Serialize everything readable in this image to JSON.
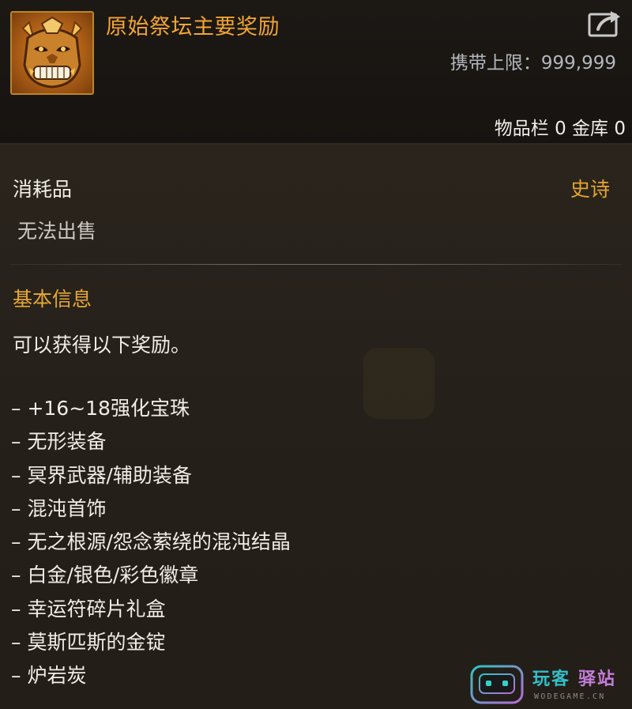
{
  "item": {
    "title": "原始祭坛主要奖励",
    "icon": "golden-demon-mask-icon",
    "carry_limit": "携带上限：999,999",
    "storage": "物品栏 0 金库 0",
    "category": "消耗品",
    "rarity": "史诗",
    "rarity_color": "#e6a52d",
    "sell_status": "无法出售"
  },
  "info": {
    "section_title": "基本信息",
    "description": "可以获得以下奖励。",
    "rewards": [
      "– +16~18强化宝珠",
      "– 无形装备",
      "– 冥界武器/辅助装备",
      "– 混沌首饰",
      "– 无之根源/怨念萦绕的混沌结晶",
      "– 白金/银色/彩色徽章",
      "– 幸运符碎片礼盒",
      "– 莫斯匹斯的金锭",
      "– 炉岩炭"
    ]
  },
  "watermark": {
    "brand_a": "玩客",
    "brand_b": "驿站",
    "site": "WODEGAME.CN",
    "icon": "gamepad-face-logo"
  }
}
